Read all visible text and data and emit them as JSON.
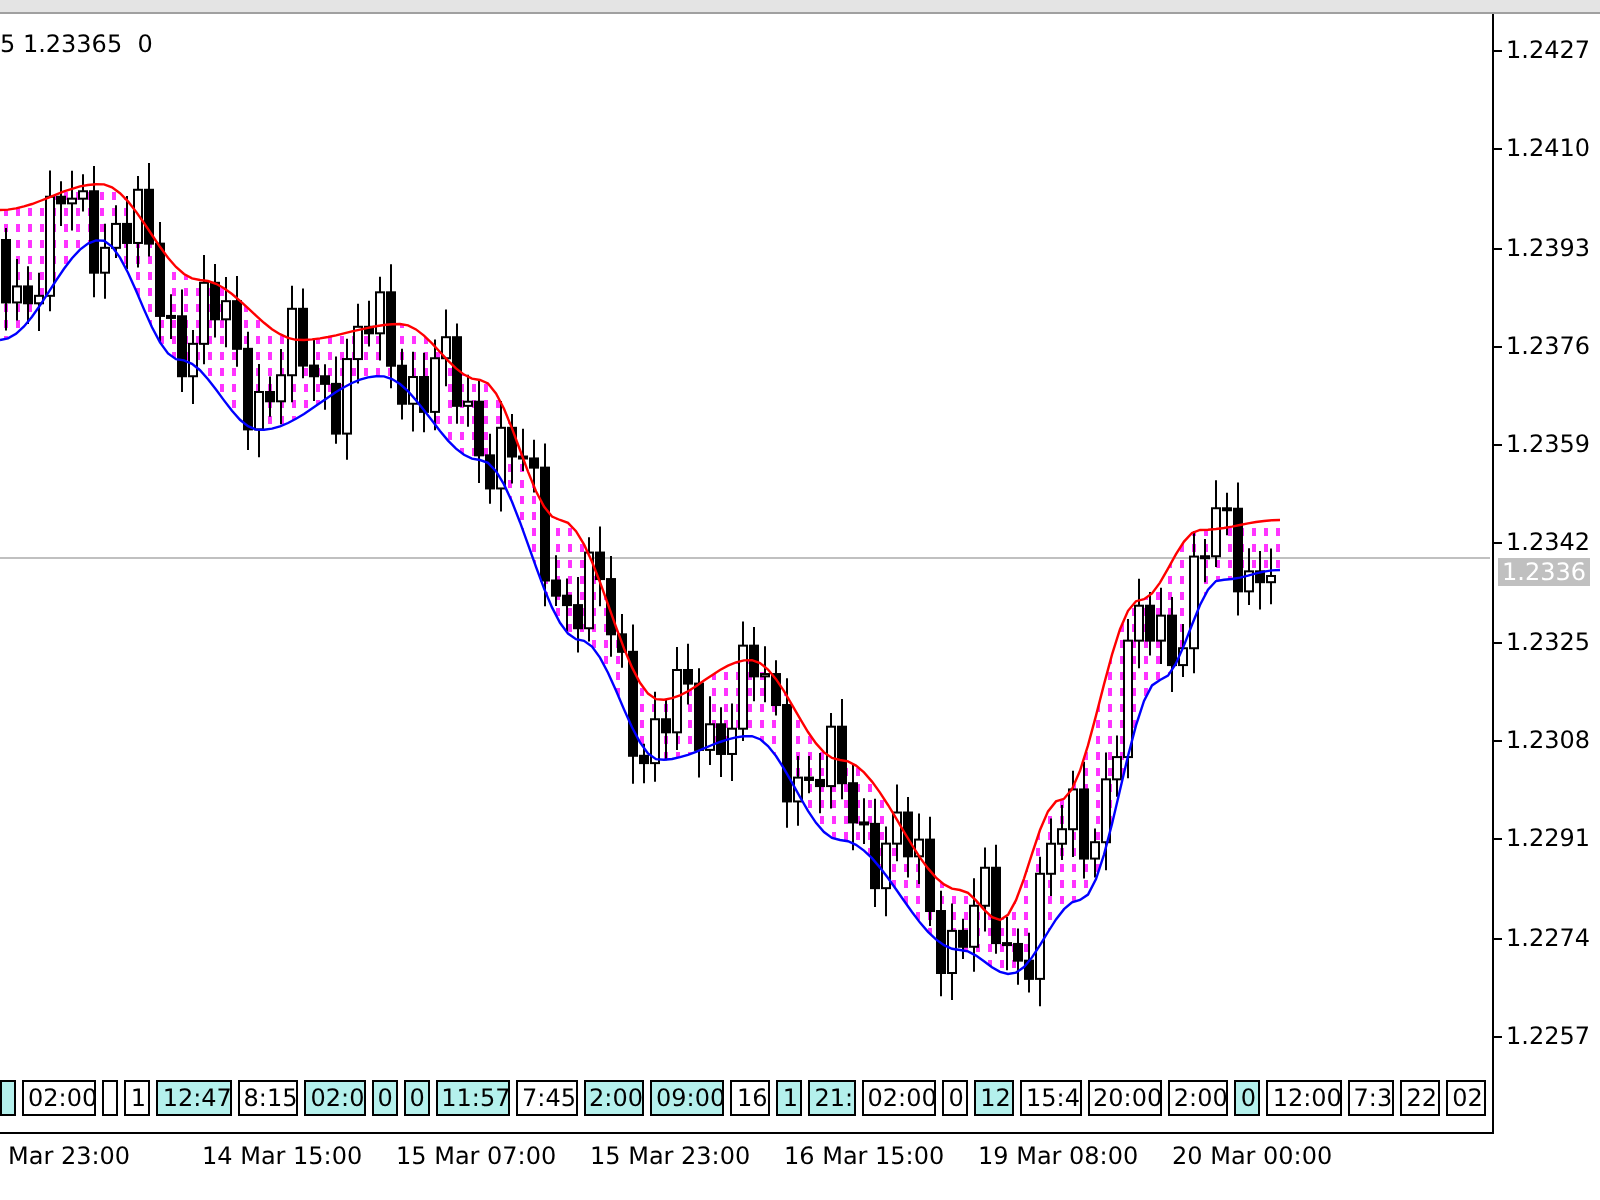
{
  "info_line": "5 1.23365  0",
  "price_axis": [
    "1.2427",
    "1.2410",
    "1.2393",
    "1.2376",
    "1.2359",
    "1.2342",
    "1.2325",
    "1.2308",
    "1.2291",
    "1.2274",
    "1.2257"
  ],
  "current_price": "1.2336",
  "tags": [
    {
      "highlighted": true
    },
    {
      "text": "02:00",
      "highlighted": false
    },
    {
      "highlighted": false
    },
    {
      "text": "1",
      "highlighted": false
    },
    {
      "text": "12:47",
      "highlighted": true
    },
    {
      "text": "8:15",
      "highlighted": false
    },
    {
      "text": "02:0",
      "highlighted": true
    },
    {
      "text": "0",
      "highlighted": true
    },
    {
      "text": "0",
      "highlighted": true
    },
    {
      "text": "11:57",
      "highlighted": true
    },
    {
      "text": "7:45",
      "highlighted": false
    },
    {
      "text": "2:00",
      "highlighted": true
    },
    {
      "text": "09:00",
      "highlighted": true
    },
    {
      "text": "16",
      "highlighted": false
    },
    {
      "text": "1",
      "highlighted": true
    },
    {
      "text": "21:",
      "highlighted": true
    },
    {
      "text": "02:00",
      "highlighted": false
    },
    {
      "text": "0",
      "highlighted": false
    },
    {
      "text": "12",
      "highlighted": true
    },
    {
      "text": "15:4",
      "highlighted": false
    },
    {
      "text": "20:00",
      "highlighted": false
    },
    {
      "text": "2:00",
      "highlighted": false
    },
    {
      "text": "0",
      "highlighted": true
    },
    {
      "text": "12:00",
      "highlighted": false
    },
    {
      "text": "7:3",
      "highlighted": false
    },
    {
      "text": "22",
      "highlighted": false
    },
    {
      "text": "02",
      "highlighted": false
    }
  ],
  "time_axis": [
    "Mar 23:00",
    "14 Mar 15:00",
    "15 Mar 07:00",
    "15 Mar 23:00",
    "16 Mar 15:00",
    "19 Mar 08:00",
    "20 Mar 00:00"
  ]
}
